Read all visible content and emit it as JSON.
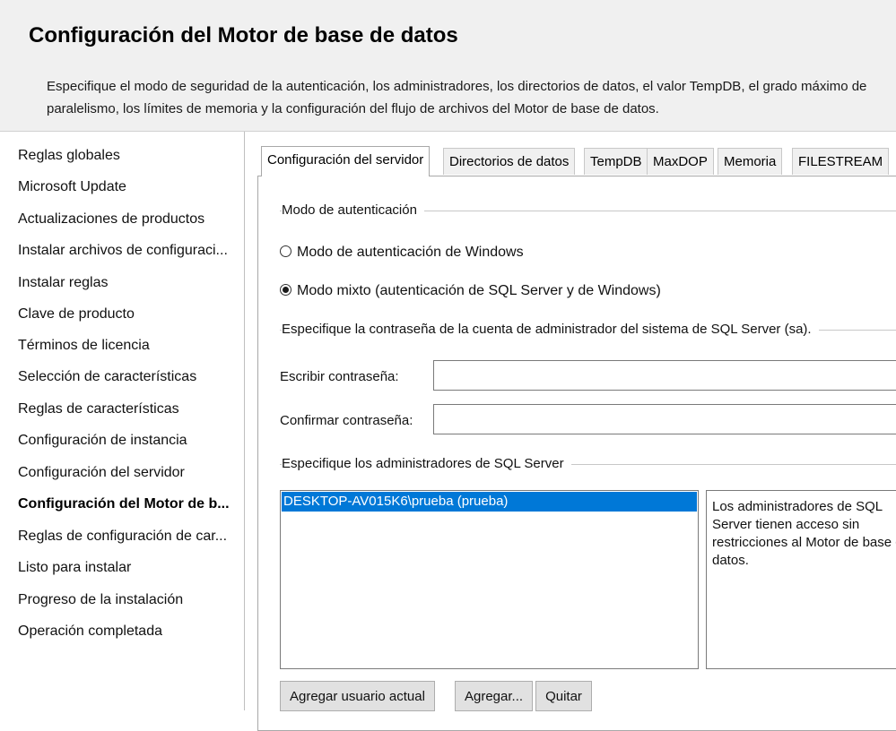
{
  "header": {
    "title": "Configuración del Motor de base de datos",
    "description": "Especifique el modo de seguridad de la autenticación, los administradores, los directorios de datos, el valor TempDB, el grado máximo de paralelismo, los límites de memoria y la configuración del flujo de archivos del Motor de base de datos."
  },
  "sidebar": {
    "items": [
      {
        "label": "Reglas globales"
      },
      {
        "label": "Microsoft Update"
      },
      {
        "label": "Actualizaciones de productos"
      },
      {
        "label": "Instalar archivos de configuraci..."
      },
      {
        "label": "Instalar reglas"
      },
      {
        "label": "Clave de producto"
      },
      {
        "label": "Términos de licencia"
      },
      {
        "label": "Selección de características"
      },
      {
        "label": "Reglas de características"
      },
      {
        "label": "Configuración de instancia"
      },
      {
        "label": "Configuración del servidor"
      },
      {
        "label": "Configuración del Motor de b...",
        "active": true
      },
      {
        "label": "Reglas de configuración de car..."
      },
      {
        "label": "Listo para instalar"
      },
      {
        "label": "Progreso de la instalación"
      },
      {
        "label": "Operación completada"
      }
    ]
  },
  "tabs": [
    {
      "label": "Configuración del servidor",
      "active": true
    },
    {
      "label": "Directorios de datos"
    },
    {
      "label": "TempDB"
    },
    {
      "label": "MaxDOP"
    },
    {
      "label": "Memoria"
    },
    {
      "label": "FILESTREAM"
    }
  ],
  "auth": {
    "group_label": "Modo de autenticación",
    "windows_mode": "Modo de autenticación de Windows",
    "mixed_mode": "Modo mixto (autenticación de SQL Server y de Windows)",
    "selected": "mixed_mode"
  },
  "password": {
    "group_label": "Especifique la contraseña de la cuenta de administrador del sistema de SQL Server (sa).",
    "enter_label": "Escribir contraseña:",
    "confirm_label": "Confirmar contraseña:",
    "enter_value": "",
    "confirm_value": ""
  },
  "admins": {
    "group_label": "Especifique los administradores de SQL Server",
    "items": [
      "DESKTOP-AV015K6\\prueba (prueba)"
    ],
    "info": "Los administradores de SQL Server tienen acceso sin restricciones al Motor de base de datos."
  },
  "buttons": {
    "add_current": "Agregar usuario actual",
    "add": "Agregar...",
    "remove": "Quitar"
  },
  "colors": {
    "selection": "#0078d7",
    "header_bg": "#f0f0f0"
  }
}
